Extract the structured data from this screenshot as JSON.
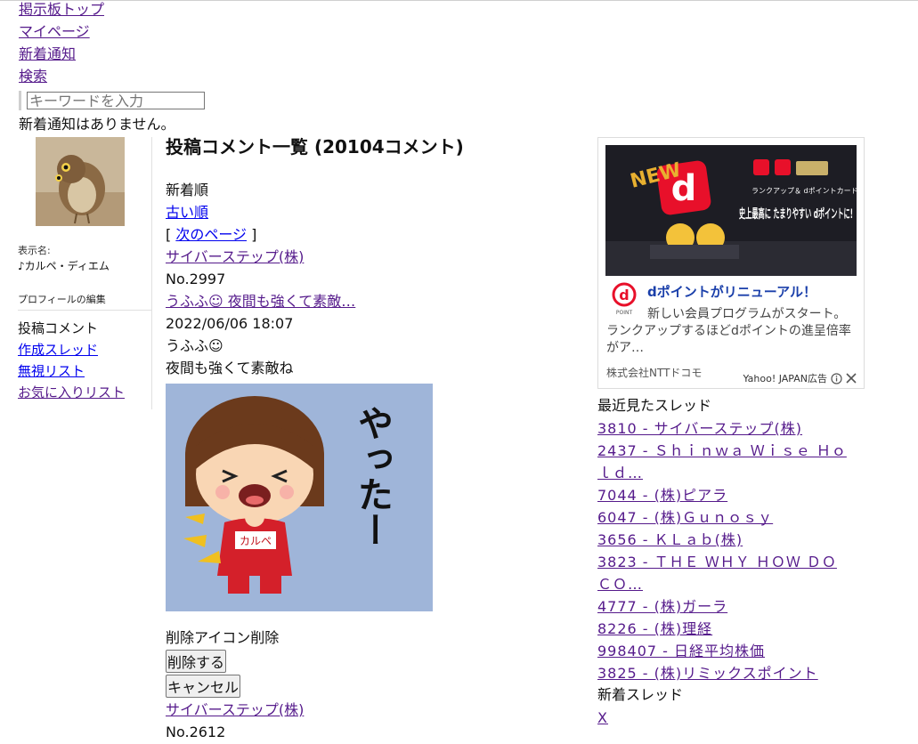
{
  "nav": {
    "items": [
      "掲示板トップ",
      "マイページ",
      "新着通知",
      "検索"
    ],
    "search_placeholder": "キーワードを入力",
    "notice": "新着通知はありません。"
  },
  "profile": {
    "display_label": "表示名:",
    "display_name": "♪カルペ・ディエム",
    "edit_label": "プロフィールの編集",
    "menu": {
      "current": "投稿コメント",
      "links": [
        "作成スレッド",
        "無視リスト",
        "お気に入りリスト"
      ]
    }
  },
  "main": {
    "title": "投稿コメント一覧 (20104コメント)",
    "sort_current": "新着順",
    "sort_old": "古い順",
    "pager_open": "[",
    "pager_next": "次のページ",
    "pager_close": "]",
    "post": {
      "company": "サイバーステップ(株)",
      "number": "No.2997",
      "thread_link": "うふふ☺ 夜間も強くて素敵…",
      "datetime": "2022/06/06 18:07",
      "body_line1": "うふふ☺",
      "body_line2": "夜間も強くて素敵ね",
      "sticker_name_tag": "カルペ",
      "sticker_text": "やったー"
    },
    "delete_heading": "削除アイコン削除",
    "delete_button": "削除する",
    "cancel_button": "キャンセル",
    "next_company": "サイバーステップ(株)",
    "next_number_partial": "No.2612"
  },
  "ad": {
    "image_badge": "NEW",
    "image_text_small": "ランクアップ＆ dポイントカードご利用で",
    "image_text_large": "史上最高に たまりやすい dポイントに!",
    "title": "dポイントがリニューアル！",
    "body_line1": "新しい会員プログラムがスタート。",
    "body_line2": "ランクアップするほどdポイントの進呈倍率がア…",
    "sponsor": "株式会社NTTドコモ",
    "label": "Yahoo! JAPAN広告"
  },
  "recent": {
    "heading": "最近見たスレッド",
    "items": [
      "3810 - サイバーステップ(株)",
      "2437 - Ｓｈｉｎｗａ Ｗｉｓｅ Ｈｏｌｄ…",
      "7044 - (株)ピアラ",
      "6047 - (株)Ｇｕｎｏｓｙ",
      "3656 - ＫＬａｂ(株)",
      "3823 - ＴＨＥ ＷＨＹ ＨＯＷ ＤＯ ＣＯ…",
      "4777 - (株)ガーラ",
      "8226 - (株)理経",
      "998407 - 日経平均株価",
      "3825 - (株)リミックスポイント"
    ]
  },
  "new_threads": {
    "heading": "新着スレッド",
    "items": [
      "X"
    ]
  },
  "colors": {
    "link_visited": "#551a8b",
    "link": "#0000ee",
    "ad_title": "#1a3faa",
    "sticker_bg": "#9fb5d9"
  }
}
